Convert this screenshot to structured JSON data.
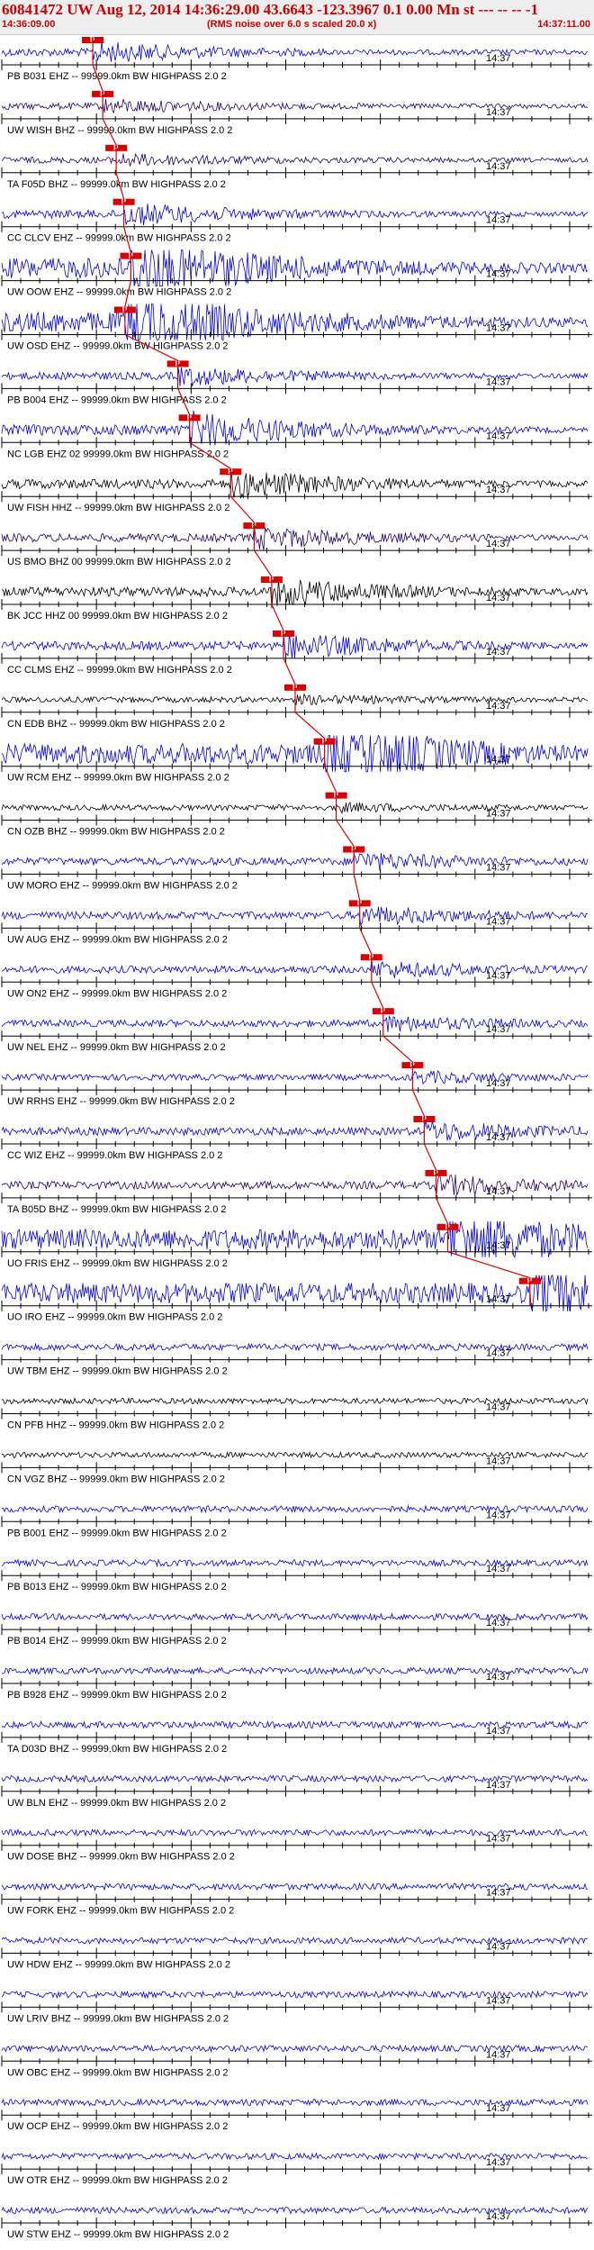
{
  "header": {
    "title": "60841472 UW Aug 12, 2014 14:36:29.00   43.6643 -123.3967  0.1 0.00 Mn st --- -- --   -1",
    "start_time": "14:36:09.00",
    "rms_note": "(RMS noise over 6.0 s scaled 20.0 x)",
    "end_time": "14:37:11.00"
  },
  "time_axis": {
    "minute_label": "14:37"
  },
  "pick_label": "P",
  "colors": {
    "header_text": "#cc0000",
    "trace_blue": "#0000ee",
    "trace_black": "#000000",
    "trace_purple": "#220066",
    "pick_red": "#dd0000",
    "axis": "#000000"
  },
  "channels": [
    {
      "label": "PB B031 EHZ -- 99999.0km BW  HIGHPASS  2.0  2",
      "color": "blue",
      "pick": 0.155,
      "amp": 0.55,
      "burst_end": 0.55
    },
    {
      "label": "UW WISH BHZ -- 99999.0km BW  HIGHPASS  2.0  2",
      "color": "purple",
      "pick": 0.172,
      "amp": 0.35
    },
    {
      "label": "TA F05D BHZ -- 99999.0km BW  HIGHPASS  2.0  2",
      "color": "purple",
      "pick": 0.195,
      "amp": 0.3
    },
    {
      "label": "CC CLCV EHZ -- 99999.0km BW  HIGHPASS  2.0  2",
      "color": "blue",
      "pick": 0.208,
      "amp": 0.6,
      "burst_end": 1.0
    },
    {
      "label": "UW OOW EHZ -- 99999.0km BW  HIGHPASS  2.0  2",
      "color": "blue",
      "pick": 0.22,
      "amp": 0.9,
      "clip": true
    },
    {
      "label": "UW OSD EHZ -- 99999.0km BW  HIGHPASS  2.0  2",
      "color": "blue",
      "pick": 0.21,
      "amp": 0.9,
      "clip": true
    },
    {
      "label": "PB B004 EHZ -- 99999.0km BW  HIGHPASS  2.0  2",
      "color": "blue",
      "pick": 0.3,
      "amp": 0.5
    },
    {
      "label": "NC LGB EHZ 02 99999.0km BW  HIGHPASS  2.0  2",
      "color": "blue",
      "pick": 0.32,
      "amp": 1.0,
      "burst_end": 1.0
    },
    {
      "label": "UW FISH HHZ -- 99999.0km BW  HIGHPASS  2.0  2",
      "color": "black",
      "pick": 0.39,
      "amp": 0.8
    },
    {
      "label": "US BMO BHZ 00 99999.0km BW  HIGHPASS  2.0  2",
      "color": "purple",
      "pick": 0.43,
      "amp": 0.6
    },
    {
      "label": "BK JCC HHZ 00 99999.0km BW  HIGHPASS  2.0  2",
      "color": "black",
      "pick": 0.46,
      "amp": 0.8
    },
    {
      "label": "CC CLMS EHZ -- 99999.0km BW  HIGHPASS  2.0  2",
      "color": "blue",
      "pick": 0.48,
      "amp": 0.7
    },
    {
      "label": "CN EDB BHZ -- 99999.0km BW  HIGHPASS  2.0  2",
      "color": "black",
      "pick": 0.5,
      "amp": 0.2
    },
    {
      "label": "UW RCM EHZ -- 99999.0km BW  HIGHPASS  2.0  2",
      "color": "blue",
      "pick": 0.55,
      "amp": 0.9,
      "clip": true
    },
    {
      "label": "CN OZB BHZ -- 99999.0km BW  HIGHPASS  2.0  2",
      "color": "black",
      "pick": 0.57,
      "amp": 0.2
    },
    {
      "label": "UW MORO EHZ -- 99999.0km BW  HIGHPASS  2.0  2",
      "color": "blue",
      "pick": 0.6,
      "amp": 0.5
    },
    {
      "label": "UW AUG EHZ -- 99999.0km BW  HIGHPASS  2.0  2",
      "color": "blue",
      "pick": 0.61,
      "amp": 0.5
    },
    {
      "label": "UW ON2 EHZ -- 99999.0km BW  HIGHPASS  2.0  2",
      "color": "blue",
      "pick": 0.63,
      "amp": 0.45
    },
    {
      "label": "UW NEL EHZ -- 99999.0km BW  HIGHPASS  2.0  2",
      "color": "blue",
      "pick": 0.65,
      "amp": 0.4
    },
    {
      "label": "UW RRHS EHZ -- 99999.0km BW  HIGHPASS  2.0  2",
      "color": "blue",
      "pick": 0.7,
      "amp": 0.3
    },
    {
      "label": "CC WIZ EHZ -- 99999.0km BW  HIGHPASS  2.0  2",
      "color": "blue",
      "pick": 0.72,
      "amp": 0.55
    },
    {
      "label": "TA B05D BHZ -- 99999.0km BW  HIGHPASS  2.0  2",
      "color": "purple",
      "pick": 0.74,
      "amp": 0.55
    },
    {
      "label": "UO FRIS EHZ -- 99999.0km BW  HIGHPASS  2.0  2",
      "color": "blue",
      "pick": 0.76,
      "amp": 0.9,
      "clip": true
    },
    {
      "label": "UO IRO EHZ -- 99999.0km BW  HIGHPASS  2.0  2",
      "color": "blue",
      "pick": 0.9,
      "amp": 0.9,
      "clip": true
    },
    {
      "label": "UW TBM EHZ -- 99999.0km BW  HIGHPASS  2.0  2",
      "color": "blue",
      "amp": 0.35
    },
    {
      "label": "CN PFB HHZ -- 99999.0km BW  HIGHPASS  2.0  2",
      "color": "black",
      "amp": 0.2
    },
    {
      "label": "CN VGZ BHZ -- 99999.0km BW  HIGHPASS  2.0  2",
      "color": "black",
      "amp": 0.2
    },
    {
      "label": "PB B001 EHZ -- 99999.0km BW  HIGHPASS  2.0  2",
      "color": "blue",
      "amp": 0.3
    },
    {
      "label": "PB B013 EHZ -- 99999.0km BW  HIGHPASS  2.0  2",
      "color": "blue",
      "amp": 0.3
    },
    {
      "label": "PB B014 EHZ -- 99999.0km BW  HIGHPASS  2.0  2",
      "color": "blue",
      "amp": 0.3
    },
    {
      "label": "PB B928 EHZ -- 99999.0km BW  HIGHPASS  2.0  2",
      "color": "blue",
      "amp": 0.3
    },
    {
      "label": "TA D03D BHZ -- 99999.0km BW  HIGHPASS  2.0  2",
      "color": "blue",
      "amp": 0.35
    },
    {
      "label": "UW BLN EHZ -- 99999.0km BW  HIGHPASS  2.0  2",
      "color": "blue",
      "amp": 0.3
    },
    {
      "label": "UW DOSE BHZ -- 99999.0km BW  HIGHPASS  2.0  2",
      "color": "blue",
      "amp": 0.3
    },
    {
      "label": "UW FORK EHZ -- 99999.0km BW  HIGHPASS  2.0  2",
      "color": "blue",
      "amp": 0.3
    },
    {
      "label": "UW HDW EHZ -- 99999.0km BW  HIGHPASS  2.0  2",
      "color": "blue",
      "amp": 0.3
    },
    {
      "label": "UW LRIV BHZ -- 99999.0km BW  HIGHPASS  2.0  2",
      "color": "blue",
      "amp": 0.3
    },
    {
      "label": "UW OBC EHZ -- 99999.0km BW  HIGHPASS  2.0  2",
      "color": "blue",
      "amp": 0.3
    },
    {
      "label": "UW OCP EHZ -- 99999.0km BW  HIGHPASS  2.0  2",
      "color": "blue",
      "amp": 0.3
    },
    {
      "label": "UW OTR EHZ -- 99999.0km BW  HIGHPASS  2.0  2",
      "color": "blue",
      "amp": 0.3
    },
    {
      "label": "UW STW EHZ -- 99999.0km BW  HIGHPASS  2.0  2",
      "color": "blue",
      "amp": 0.3
    }
  ]
}
